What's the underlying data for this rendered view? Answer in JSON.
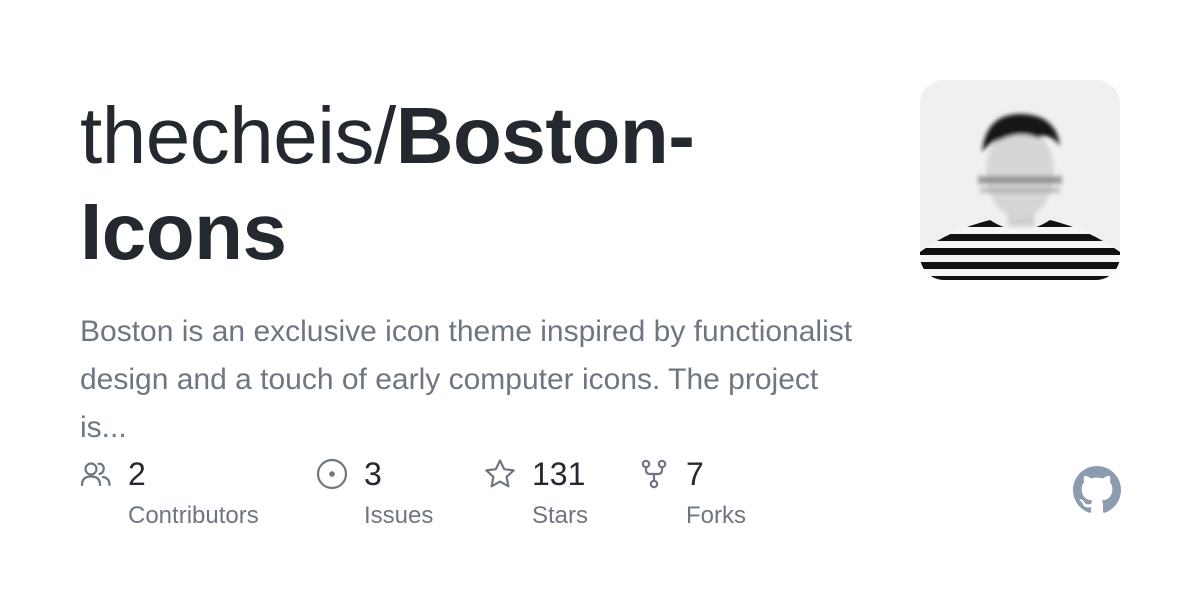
{
  "repo": {
    "owner": "thecheis/",
    "name": "Boston-Icons",
    "description": "Boston is an exclusive icon theme inspired by functionalist design and a touch of early computer icons. The project is..."
  },
  "stats": [
    {
      "icon": "people-icon",
      "value": "2",
      "label": "Contributors"
    },
    {
      "icon": "issue-icon",
      "value": "3",
      "label": "Issues"
    },
    {
      "icon": "star-icon",
      "value": "131",
      "label": "Stars"
    },
    {
      "icon": "fork-icon",
      "value": "7",
      "label": "Forks"
    }
  ],
  "colors": {
    "text": "#24292f",
    "muted": "#6e7781",
    "icon": "#6e7781",
    "github": "#8b9cb1"
  }
}
